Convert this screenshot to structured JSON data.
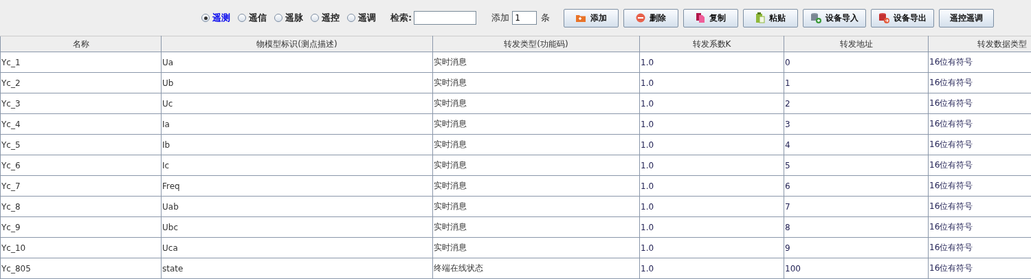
{
  "toolbar": {
    "radios": [
      {
        "label": "遥测",
        "selected": true
      },
      {
        "label": "遥信",
        "selected": false
      },
      {
        "label": "遥脉",
        "selected": false
      },
      {
        "label": "遥控",
        "selected": false
      },
      {
        "label": "遥调",
        "selected": false
      }
    ],
    "search": {
      "label": "检索:"
    },
    "add_count": {
      "label": "添加",
      "value": "1",
      "unit": "条"
    },
    "buttons": [
      {
        "label": "添加",
        "kind": "folder"
      },
      {
        "label": "删除",
        "kind": "minus"
      },
      {
        "label": "复制",
        "kind": "copy"
      },
      {
        "label": "粘贴",
        "kind": "paste"
      },
      {
        "label": "设备导入",
        "kind": "db-in"
      },
      {
        "label": "设备导出",
        "kind": "db-out"
      },
      {
        "label": "遥控遥调",
        "kind": "plain"
      }
    ]
  },
  "table": {
    "columns": [
      "名称",
      "物模型标识(测点描述)",
      "转发类型(功能码)",
      "转发系数K",
      "转发地址",
      "转发数据类型"
    ],
    "rows": [
      [
        "Yc_1",
        "Ua",
        "实时消息",
        "1.0",
        "0",
        "16位有符号"
      ],
      [
        "Yc_2",
        "Ub",
        "实时消息",
        "1.0",
        "1",
        "16位有符号"
      ],
      [
        "Yc_3",
        "Uc",
        "实时消息",
        "1.0",
        "2",
        "16位有符号"
      ],
      [
        "Yc_4",
        "Ia",
        "实时消息",
        "1.0",
        "3",
        "16位有符号"
      ],
      [
        "Yc_5",
        "Ib",
        "实时消息",
        "1.0",
        "4",
        "16位有符号"
      ],
      [
        "Yc_6",
        "Ic",
        "实时消息",
        "1.0",
        "5",
        "16位有符号"
      ],
      [
        "Yc_7",
        "Freq",
        "实时消息",
        "1.0",
        "6",
        "16位有符号"
      ],
      [
        "Yc_8",
        "Uab",
        "实时消息",
        "1.0",
        "7",
        "16位有符号"
      ],
      [
        "Yc_9",
        "Ubc",
        "实时消息",
        "1.0",
        "8",
        "16位有符号"
      ],
      [
        "Yc_10",
        "Uca",
        "实时消息",
        "1.0",
        "9",
        "16位有符号"
      ],
      [
        "Yc_805",
        "state",
        "终端在线状态",
        "1.0",
        "100",
        "16位有符号"
      ]
    ]
  }
}
